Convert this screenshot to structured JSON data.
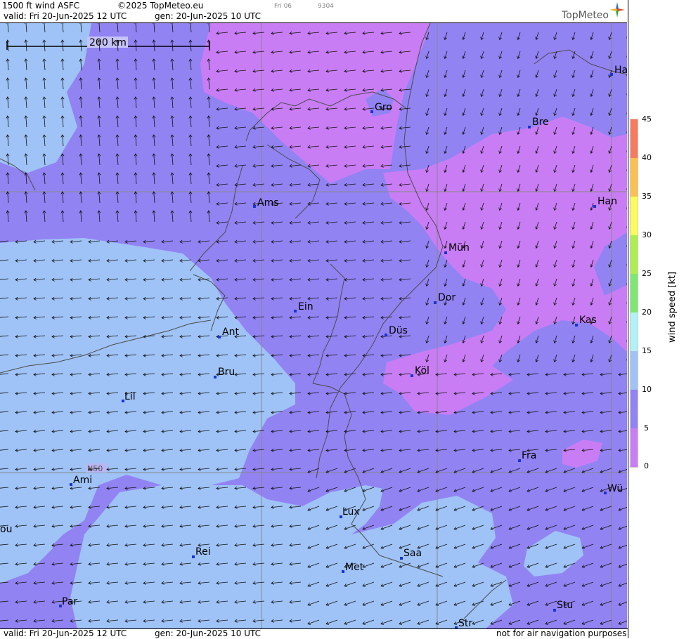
{
  "header": {
    "title": "1500 ft wind ASFC",
    "copyright": "©2025 TopMeteo.eu",
    "tab_day": "Fri 06",
    "code": "9304",
    "valid": "valid:  Fri  20-Jun-2025  12 UTC",
    "gen": "gen: 20-Jun-2025 10 UTC",
    "logo": "TopMeteo"
  },
  "footer": {
    "valid": "valid:  Fri  20-Jun-2025  12 UTC",
    "gen": "gen: 20-Jun-2025 10 UTC",
    "disclaimer": "not for air navigation purposes"
  },
  "map": {
    "scale_label": "200 km",
    "lat_label": "N50",
    "cities": [
      {
        "name": "Ha"
      },
      {
        "name": "Gro"
      },
      {
        "name": "Bre"
      },
      {
        "name": "Ams"
      },
      {
        "name": "Han"
      },
      {
        "name": "Mün"
      },
      {
        "name": "Dor"
      },
      {
        "name": "Ein"
      },
      {
        "name": "Kas"
      },
      {
        "name": "Düs"
      },
      {
        "name": "Ant"
      },
      {
        "name": "Köl"
      },
      {
        "name": "Bru"
      },
      {
        "name": "Lil"
      },
      {
        "name": "Fra"
      },
      {
        "name": "Ami"
      },
      {
        "name": "Wü"
      },
      {
        "name": "Lux"
      },
      {
        "name": "ou"
      },
      {
        "name": "Rei"
      },
      {
        "name": "Saa"
      },
      {
        "name": "Met"
      },
      {
        "name": "Stu"
      },
      {
        "name": "Par"
      },
      {
        "name": "Str"
      }
    ]
  },
  "colorbar": {
    "title": "wind  speed  [kt]",
    "ticks": [
      "45",
      "40",
      "35",
      "30",
      "25",
      "20",
      "15",
      "10",
      "5",
      "0"
    ],
    "colors": {
      "c0_5": "#c97df5",
      "c5_10": "#9283f3",
      "c10_15": "#9fc3f6",
      "c15_20": "#b2f1f5",
      "c20_25": "#7de870",
      "c25_30": "#acee4e",
      "c30_35": "#fbfb59",
      "c35_40": "#fcc051",
      "c40_45": "#f87a5d"
    }
  }
}
